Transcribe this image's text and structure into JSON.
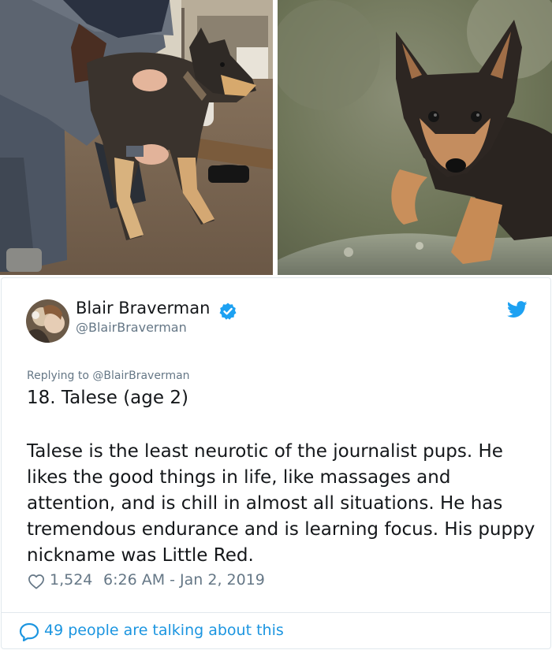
{
  "images": {
    "left": {
      "description_icon": "dog-being-massaged-photo"
    },
    "right": {
      "description_icon": "puppy-on-rock-photo"
    }
  },
  "tweet": {
    "author_name": "Blair Braverman",
    "handle": "@BlairBraverman",
    "replying_to": "Replying to @BlairBraverman",
    "title": "18. Talese (age 2)",
    "body": "Talese is the least neurotic of the journalist pups. He likes the good things in life, like massages and attention, and is chill in almost all situations. He has tremendous endurance and is learning focus. His puppy nickname was Little Red.",
    "likes": "1,524",
    "timestamp": "6:26 AM - Jan 2, 2019",
    "talking": "49 people are talking about this"
  },
  "colors": {
    "accent": "#1da1f2",
    "link": "#1b95e0",
    "secondary_text": "#657786",
    "border": "#e1e8ed"
  }
}
